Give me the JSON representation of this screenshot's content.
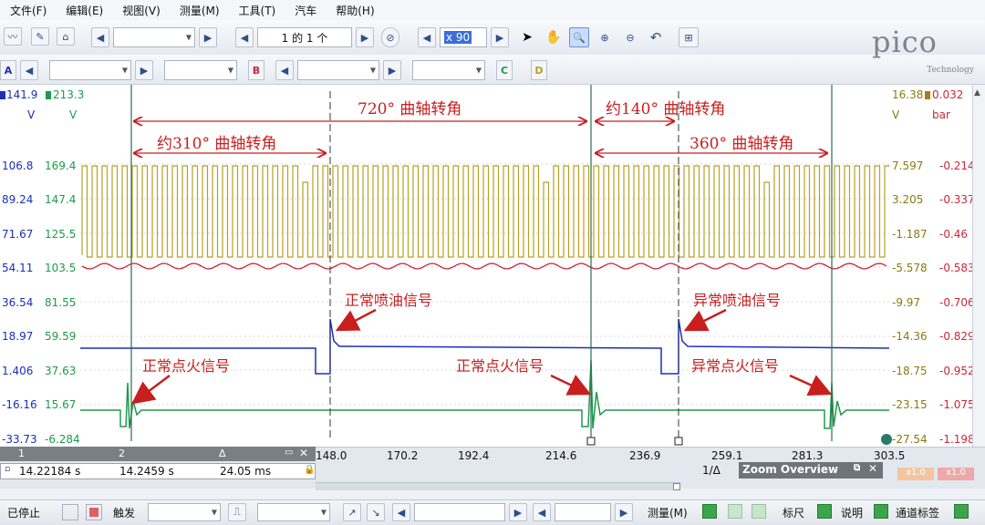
{
  "menu": [
    "文件(F)",
    "编辑(E)",
    "视图(V)",
    "测量(M)",
    "工具(T)",
    "汽车",
    "帮助(H)"
  ],
  "toolbar": {
    "page_indicator": "1 的 1 个",
    "zoom_value": "x 90"
  },
  "channel_buttons": [
    "A",
    "B",
    "C",
    "D"
  ],
  "logo": {
    "text": "pico",
    "sub": "Technology"
  },
  "axes": {
    "top_left_a": "141.9",
    "top_left_b": "213.3",
    "unit_a": "V",
    "unit_b": "V",
    "top_right_c": "16.38",
    "top_right_d": "0.032",
    "unit_c": "V",
    "unit_d": "bar",
    "left_a_ticks": [
      "106.8",
      "89.24",
      "71.67",
      "54.11",
      "36.54",
      "18.97",
      "1.406",
      "-16.16",
      "-33.73"
    ],
    "left_b_ticks": [
      "169.4",
      "147.4",
      "125.5",
      "103.5",
      "81.55",
      "59.59",
      "37.63",
      "15.67",
      "-6.284"
    ],
    "right_c_ticks": [
      "7.597",
      "3.205",
      "-1.187",
      "-5.578",
      "-9.97",
      "-14.36",
      "-18.75",
      "-23.15",
      "-27.54"
    ],
    "right_d_ticks": [
      "-0.214",
      "-0.337",
      "-0.46",
      "-0.583",
      "-0.706",
      "-0.829",
      "-0.952",
      "-1.075",
      "-1.198"
    ],
    "x_ticks": [
      "148.0",
      "170.2",
      "192.4",
      "214.6",
      "236.9",
      "259.1",
      "281.3",
      "303.5"
    ]
  },
  "annotations": {
    "span_720": "720° 曲轴转角",
    "span_310": "约310° 曲轴转角",
    "span_140": "约140° 曲轴转角",
    "span_360": "360° 曲轴转角",
    "normal_injection": "正常喷油信号",
    "abnormal_injection": "异常喷油信号",
    "normal_ignition_1": "正常点火信号",
    "normal_ignition_2": "正常点火信号",
    "abnormal_ignition": "异常点火信号"
  },
  "ruler_panel": {
    "col1": "1",
    "col2": "2",
    "col3": "Δ",
    "val1": "14.22184 s",
    "val2": "14.2459 s",
    "val3": "24.05 ms"
  },
  "zoom_overview": {
    "label": "Zoom Overview",
    "ruler_label": "1/Δ"
  },
  "scale_badges": [
    "x1.0",
    "x1.0"
  ],
  "bottombar": {
    "stopped": "已停止",
    "trigger": "触发",
    "measure": "测量(M)",
    "ruler": "标尺",
    "notes": "说明",
    "channel_labels": "通道标签"
  },
  "colors": {
    "channel_a": "#1c2fb8",
    "channel_b": "#1e9a4c",
    "channel_c": "#b7a124",
    "channel_d": "#c8283c",
    "annotation": "#c81e1e"
  }
}
